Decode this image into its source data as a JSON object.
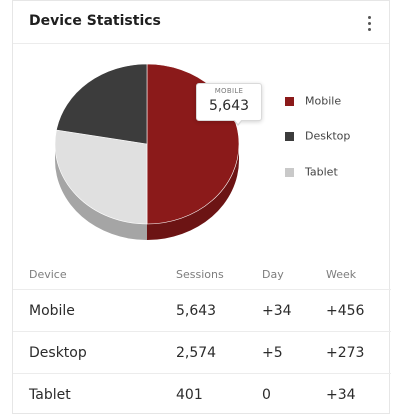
{
  "card": {
    "title": "Device Statistics",
    "menu_icon": "more-vertical-icon"
  },
  "chart_data": {
    "type": "pie",
    "categories": [
      "Mobile",
      "Desktop",
      "Tablet"
    ],
    "values": [
      5643,
      2574,
      401
    ],
    "colors": [
      "#8b1a1a",
      "#3c3c3c",
      "#e0e0e0"
    ],
    "legend_placement": "right",
    "tooltip": {
      "label": "MOBILE",
      "value": "5,643"
    }
  },
  "table": {
    "headers": [
      "Device",
      "Sessions",
      "Day",
      "Week"
    ],
    "rows": [
      {
        "device": "Mobile",
        "sessions": "5,643",
        "day": "+34",
        "week": "+456"
      },
      {
        "device": "Desktop",
        "sessions": "2,574",
        "day": "+5",
        "week": "+273"
      },
      {
        "device": "Tablet",
        "sessions": "401",
        "day": "0",
        "week": "+34"
      }
    ]
  }
}
